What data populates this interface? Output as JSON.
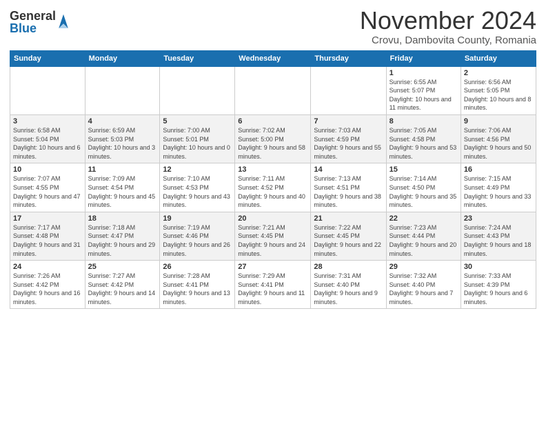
{
  "logo": {
    "general": "General",
    "blue": "Blue"
  },
  "title": "November 2024",
  "location": "Crovu, Dambovita County, Romania",
  "days_of_week": [
    "Sunday",
    "Monday",
    "Tuesday",
    "Wednesday",
    "Thursday",
    "Friday",
    "Saturday"
  ],
  "weeks": [
    [
      {
        "day": "",
        "info": ""
      },
      {
        "day": "",
        "info": ""
      },
      {
        "day": "",
        "info": ""
      },
      {
        "day": "",
        "info": ""
      },
      {
        "day": "",
        "info": ""
      },
      {
        "day": "1",
        "info": "Sunrise: 6:55 AM\nSunset: 5:07 PM\nDaylight: 10 hours and 11 minutes."
      },
      {
        "day": "2",
        "info": "Sunrise: 6:56 AM\nSunset: 5:05 PM\nDaylight: 10 hours and 8 minutes."
      }
    ],
    [
      {
        "day": "3",
        "info": "Sunrise: 6:58 AM\nSunset: 5:04 PM\nDaylight: 10 hours and 6 minutes."
      },
      {
        "day": "4",
        "info": "Sunrise: 6:59 AM\nSunset: 5:03 PM\nDaylight: 10 hours and 3 minutes."
      },
      {
        "day": "5",
        "info": "Sunrise: 7:00 AM\nSunset: 5:01 PM\nDaylight: 10 hours and 0 minutes."
      },
      {
        "day": "6",
        "info": "Sunrise: 7:02 AM\nSunset: 5:00 PM\nDaylight: 9 hours and 58 minutes."
      },
      {
        "day": "7",
        "info": "Sunrise: 7:03 AM\nSunset: 4:59 PM\nDaylight: 9 hours and 55 minutes."
      },
      {
        "day": "8",
        "info": "Sunrise: 7:05 AM\nSunset: 4:58 PM\nDaylight: 9 hours and 53 minutes."
      },
      {
        "day": "9",
        "info": "Sunrise: 7:06 AM\nSunset: 4:56 PM\nDaylight: 9 hours and 50 minutes."
      }
    ],
    [
      {
        "day": "10",
        "info": "Sunrise: 7:07 AM\nSunset: 4:55 PM\nDaylight: 9 hours and 47 minutes."
      },
      {
        "day": "11",
        "info": "Sunrise: 7:09 AM\nSunset: 4:54 PM\nDaylight: 9 hours and 45 minutes."
      },
      {
        "day": "12",
        "info": "Sunrise: 7:10 AM\nSunset: 4:53 PM\nDaylight: 9 hours and 43 minutes."
      },
      {
        "day": "13",
        "info": "Sunrise: 7:11 AM\nSunset: 4:52 PM\nDaylight: 9 hours and 40 minutes."
      },
      {
        "day": "14",
        "info": "Sunrise: 7:13 AM\nSunset: 4:51 PM\nDaylight: 9 hours and 38 minutes."
      },
      {
        "day": "15",
        "info": "Sunrise: 7:14 AM\nSunset: 4:50 PM\nDaylight: 9 hours and 35 minutes."
      },
      {
        "day": "16",
        "info": "Sunrise: 7:15 AM\nSunset: 4:49 PM\nDaylight: 9 hours and 33 minutes."
      }
    ],
    [
      {
        "day": "17",
        "info": "Sunrise: 7:17 AM\nSunset: 4:48 PM\nDaylight: 9 hours and 31 minutes."
      },
      {
        "day": "18",
        "info": "Sunrise: 7:18 AM\nSunset: 4:47 PM\nDaylight: 9 hours and 29 minutes."
      },
      {
        "day": "19",
        "info": "Sunrise: 7:19 AM\nSunset: 4:46 PM\nDaylight: 9 hours and 26 minutes."
      },
      {
        "day": "20",
        "info": "Sunrise: 7:21 AM\nSunset: 4:45 PM\nDaylight: 9 hours and 24 minutes."
      },
      {
        "day": "21",
        "info": "Sunrise: 7:22 AM\nSunset: 4:45 PM\nDaylight: 9 hours and 22 minutes."
      },
      {
        "day": "22",
        "info": "Sunrise: 7:23 AM\nSunset: 4:44 PM\nDaylight: 9 hours and 20 minutes."
      },
      {
        "day": "23",
        "info": "Sunrise: 7:24 AM\nSunset: 4:43 PM\nDaylight: 9 hours and 18 minutes."
      }
    ],
    [
      {
        "day": "24",
        "info": "Sunrise: 7:26 AM\nSunset: 4:42 PM\nDaylight: 9 hours and 16 minutes."
      },
      {
        "day": "25",
        "info": "Sunrise: 7:27 AM\nSunset: 4:42 PM\nDaylight: 9 hours and 14 minutes."
      },
      {
        "day": "26",
        "info": "Sunrise: 7:28 AM\nSunset: 4:41 PM\nDaylight: 9 hours and 13 minutes."
      },
      {
        "day": "27",
        "info": "Sunrise: 7:29 AM\nSunset: 4:41 PM\nDaylight: 9 hours and 11 minutes."
      },
      {
        "day": "28",
        "info": "Sunrise: 7:31 AM\nSunset: 4:40 PM\nDaylight: 9 hours and 9 minutes."
      },
      {
        "day": "29",
        "info": "Sunrise: 7:32 AM\nSunset: 4:40 PM\nDaylight: 9 hours and 7 minutes."
      },
      {
        "day": "30",
        "info": "Sunrise: 7:33 AM\nSunset: 4:39 PM\nDaylight: 9 hours and 6 minutes."
      }
    ]
  ]
}
